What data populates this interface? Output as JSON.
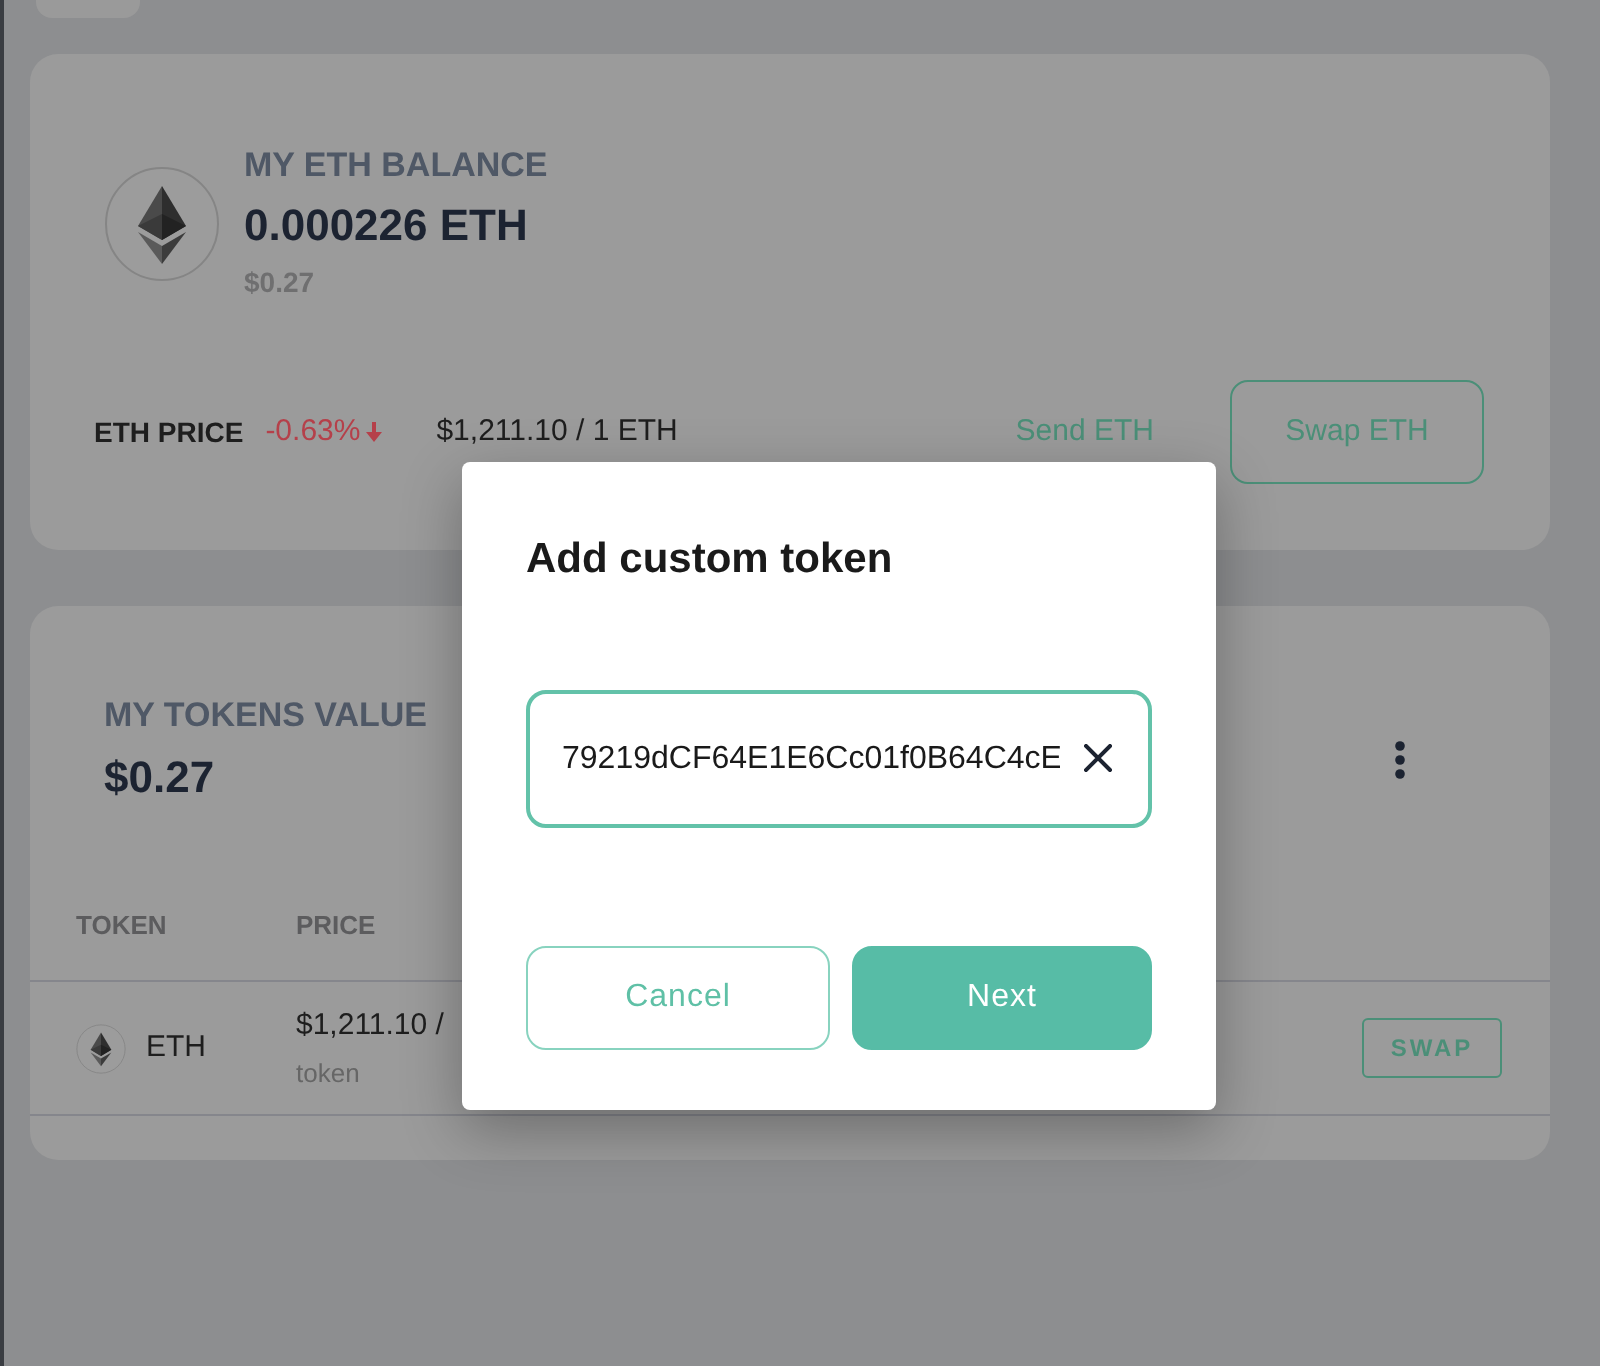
{
  "balance_card": {
    "title": "MY ETH BALANCE",
    "amount": "0.000226 ETH",
    "fiat": "$0.27",
    "price_label": "ETH PRICE",
    "change": "-0.63%",
    "falling": true,
    "price": "$1,211.10 / 1 ETH",
    "actions": [
      {
        "label": "Send ETH",
        "kind": "text"
      },
      {
        "label": "Swap ETH",
        "kind": "outline"
      }
    ]
  },
  "tokens_card": {
    "title": "MY TOKENS VALUE",
    "total": "$0.27",
    "table": {
      "columns": [
        "TOKEN",
        "PRICE"
      ],
      "rows": [
        {
          "token": "ETH",
          "price": "$1,211.10 /",
          "price_unit": "token",
          "action": "SWAP"
        }
      ]
    }
  },
  "dialog": {
    "title": "Add custom token",
    "address_field": {
      "value": "79219dCF64E1E6Cc01f0B64C4cE"
    },
    "buttons": [
      {
        "label": "Cancel",
        "kind": "secondary"
      },
      {
        "label": "Next",
        "kind": "primary"
      }
    ]
  }
}
